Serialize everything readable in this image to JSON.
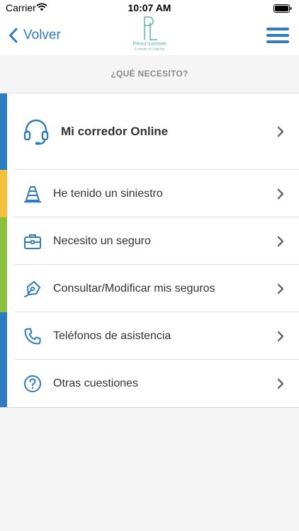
{
  "status_bar": {
    "carrier": "Carrier",
    "time": "10:07 AM"
  },
  "nav": {
    "back_label": "Volver",
    "logo_name": "Pérez-Lorente",
    "logo_subtitle": "Corredor de Seguros",
    "brand_color": "#2f7bbf",
    "logo_color": "#5cb6a6"
  },
  "section_header": "¿QUÉ NECESITO?",
  "menu": [
    {
      "label": "Mi corredor Online",
      "icon": "headset-icon",
      "stripe_color": "#2f7bbf"
    },
    {
      "label": "He tenido un siniestro",
      "icon": "road-cone-icon",
      "stripe_color": "#f3c13a"
    },
    {
      "label": "Necesito un seguro",
      "icon": "briefcase-icon",
      "stripe_color": "#8dbf3f"
    },
    {
      "label": "Consultar/Modificar mis seguros",
      "icon": "pen-icon",
      "stripe_color": "#8dbf3f"
    },
    {
      "label": "Teléfonos de asistencia",
      "icon": "phone-icon",
      "stripe_color": "#2f7bbf"
    },
    {
      "label": "Otras cuestiones",
      "icon": "question-icon",
      "stripe_color": "#2f7bbf"
    }
  ]
}
